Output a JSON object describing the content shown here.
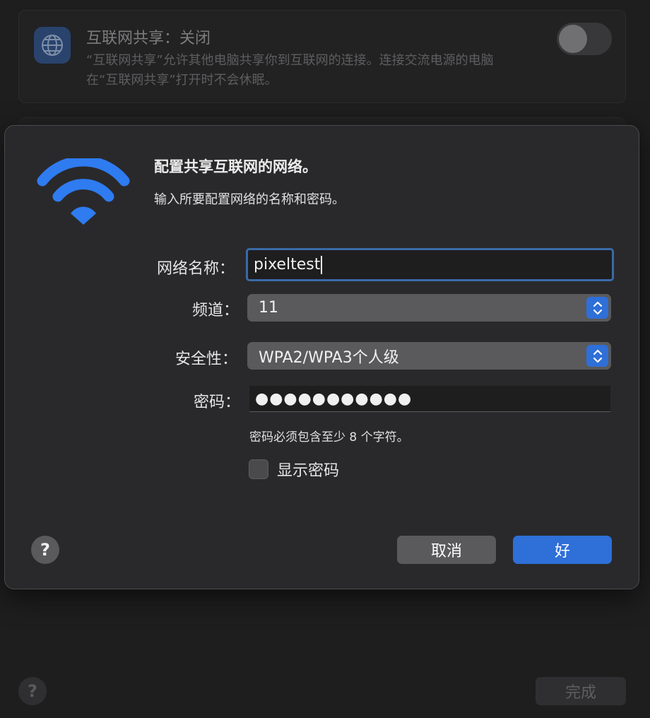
{
  "background": {
    "sharing": {
      "title": "互联网共享：关闭",
      "description": "“互联网共享”允许其他电脑共享你到互联网的连接。连接交流电源的电脑在“互联网共享”打开时不会休眠。",
      "toggle_on": false
    },
    "help_label": "?",
    "done_label": "完成"
  },
  "dialog": {
    "title": "配置共享互联网的网络。",
    "subtitle": "输入所要配置网络的名称和密码。",
    "fields": {
      "network_name_label": "网络名称：",
      "network_name_value": "pixeltest",
      "channel_label": "频道：",
      "channel_value": "11",
      "security_label": "安全性：",
      "security_value": "WPA2/WPA3个人级",
      "password_label": "密码：",
      "password_value": "●●●●●●●●●●●",
      "password_hint": "密码必须包含至少 8 个字符。",
      "show_password_label": "显示密码",
      "show_password_checked": false
    },
    "help_label": "?",
    "cancel_label": "取消",
    "ok_label": "好"
  },
  "colors": {
    "accent": "#2e6fd8",
    "wifi_icon": "#2f7bf0"
  },
  "icons": {
    "sharing": "globe-icon",
    "wifi": "wifi-icon",
    "stepper": "up-down-chevron-icon"
  }
}
